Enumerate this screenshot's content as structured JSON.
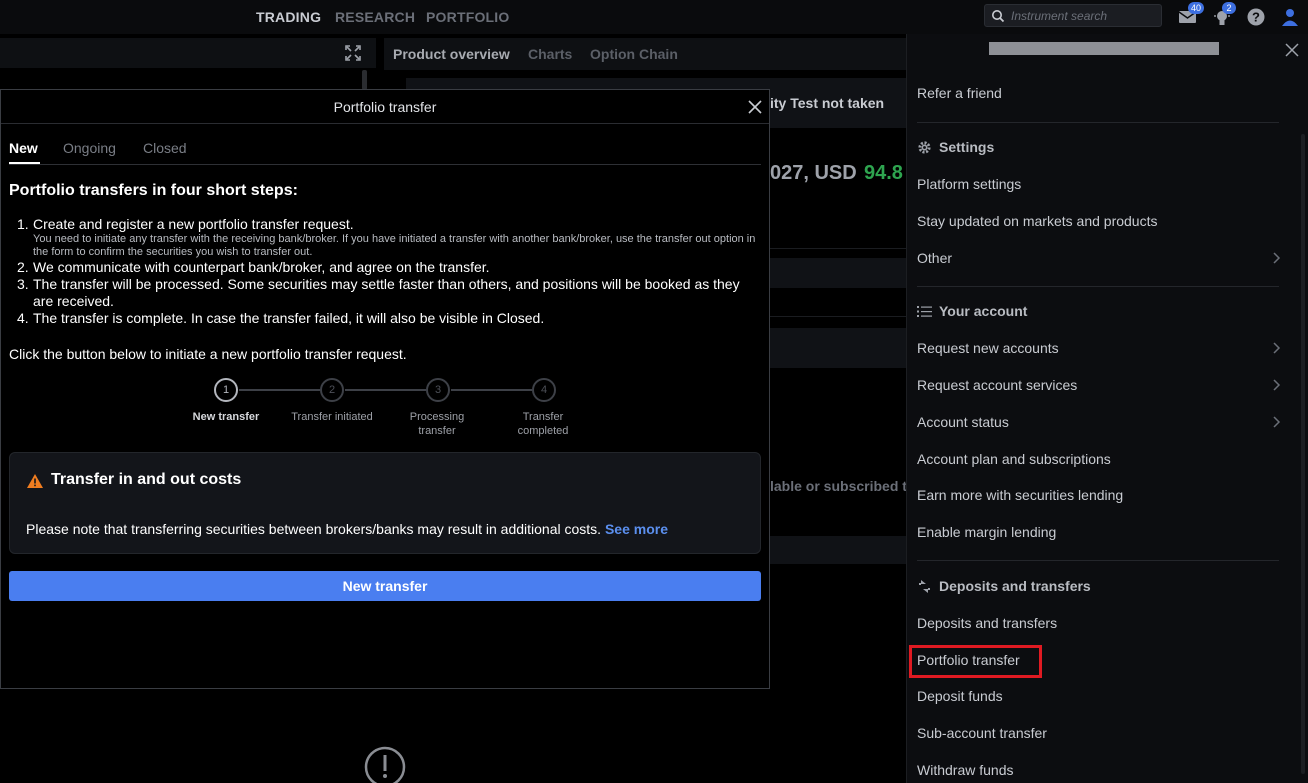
{
  "nav": {
    "items": [
      "TRADING",
      "RESEARCH",
      "PORTFOLIO"
    ],
    "active": "TRADING"
  },
  "search": {
    "placeholder": "Instrument search"
  },
  "top_icons": {
    "messages_badge": "40",
    "notifications_badge": "2"
  },
  "center": {
    "tabs": [
      "Product overview",
      "Charts",
      "Option Chain"
    ],
    "test_text": "ity Test not taken",
    "price_text": "027, USD",
    "price_value": "94.8",
    "subscribed_text": "lable or subscribed t"
  },
  "modal": {
    "title": "Portfolio transfer",
    "tabs": [
      "New",
      "Ongoing",
      "Closed"
    ],
    "heading": "Portfolio transfers in four short steps:",
    "steps": [
      {
        "num": "1.",
        "text": "Create and register a new portfolio transfer request.",
        "sub": "You need to initiate any transfer with the receiving bank/broker. If you have initiated a transfer with another bank/broker, use the transfer out option in the form to confirm the securities you wish to transfer out."
      },
      {
        "num": "2.",
        "text": "We communicate with counterpart bank/broker, and agree on the transfer.",
        "sub": ""
      },
      {
        "num": "3.",
        "text": "The transfer will be processed. Some securities may settle faster than others, and positions will be booked as they are received.",
        "sub": ""
      },
      {
        "num": "4.",
        "text": "The transfer is complete. In case the transfer failed, it will also be visible in Closed.",
        "sub": ""
      }
    ],
    "click_text": "Click the button below to initiate a new portfolio transfer request.",
    "stepper": [
      {
        "num": "1",
        "label": "New transfer",
        "active": true
      },
      {
        "num": "2",
        "label": "Transfer initiated",
        "active": false
      },
      {
        "num": "3",
        "label": "Processing transfer",
        "active": false
      },
      {
        "num": "4",
        "label": "Transfer completed",
        "active": false
      }
    ],
    "costs": {
      "title": "Transfer in and out costs",
      "text": "Please note that transferring securities between brokers/banks may result in additional costs.",
      "link": "See more"
    },
    "button": "New transfer"
  },
  "drawer": {
    "refer": "Refer a friend",
    "settings_head": "Settings",
    "settings_items": [
      "Platform settings",
      "Stay updated on markets and products",
      "Other"
    ],
    "account_head": "Your account",
    "account_items": [
      "Request new accounts",
      "Request account services",
      "Account status",
      "Account plan and subscriptions",
      "Earn more with securities lending",
      "Enable margin lending"
    ],
    "deposits_head": "Deposits and transfers",
    "deposits_items": [
      "Deposits and transfers",
      "Portfolio transfer",
      "Deposit funds",
      "Sub-account transfer",
      "Withdraw funds"
    ]
  },
  "colors": {
    "accent": "#4a7ef0",
    "link": "#5b8fee",
    "highlight": "#e01a22",
    "warning": "#f07d20",
    "price_green": "#2ea44f"
  }
}
